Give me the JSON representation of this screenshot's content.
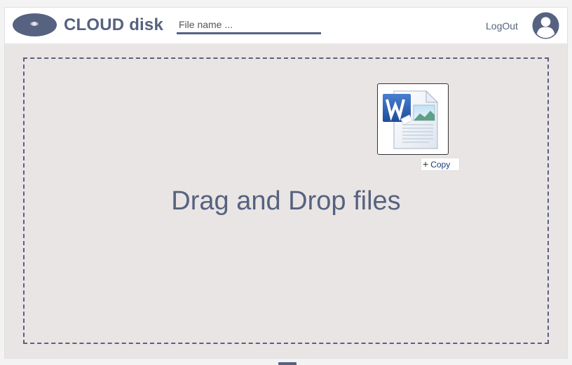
{
  "header": {
    "brand": "CLOUD disk",
    "search_placeholder": "File name ...",
    "search_value": "",
    "logout_label": "LogOut"
  },
  "main": {
    "drop_text": "Drag and Drop files"
  },
  "drag": {
    "file_icon": "word-document-icon",
    "badge_label": "Copy",
    "badge_icon": "plus-icon"
  },
  "colors": {
    "accent": "#56627f",
    "background": "#e9e5e4",
    "header_bg": "#ffffff"
  }
}
